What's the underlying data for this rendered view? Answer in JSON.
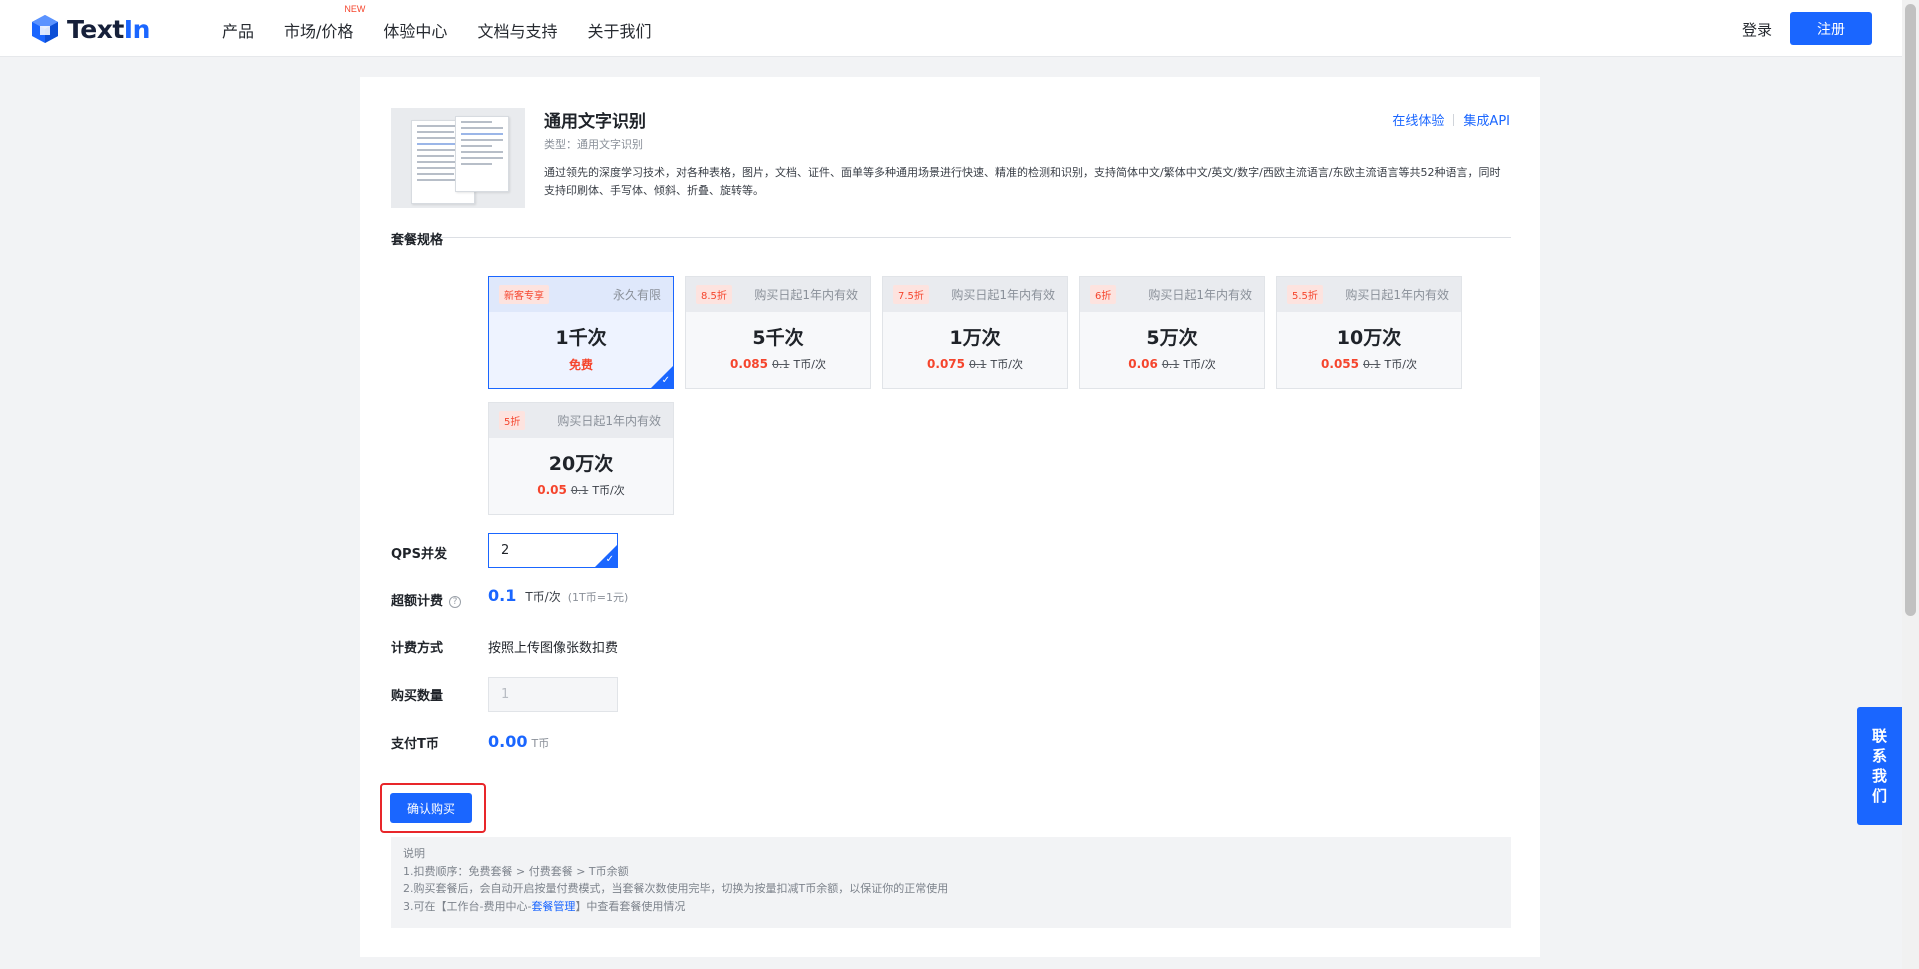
{
  "header": {
    "logo": {
      "text_main": "Text",
      "text_accent": "In"
    },
    "nav": [
      {
        "label": "产品"
      },
      {
        "label": "市场/价格",
        "badge": "NEW"
      },
      {
        "label": "体验中心"
      },
      {
        "label": "文档与支持"
      },
      {
        "label": "关于我们"
      }
    ],
    "login_label": "登录",
    "register_label": "注册"
  },
  "product": {
    "title": "通用文字识别",
    "type": "类型：通用文字识别",
    "description": "通过领先的深度学习技术，对各种表格，图片，文档、证件、面单等多种通用场景进行快速、精准的检测和识别，支持简体中文/繁体中文/英文/数字/西欧主流语言/东欧主流语言等共52种语言，同时支持印刷体、手写体、倾斜、折叠、旋转等。",
    "links": {
      "online_trial": "在线体验",
      "integrate_api": "集成API"
    }
  },
  "labels": {
    "plan_spec": "套餐规格",
    "qps": "QPS并发",
    "overage": "超额计费",
    "billing_method": "计费方式",
    "quantity": "购买数量",
    "pay_tcoin": "支付T币"
  },
  "plans": [
    {
      "badge": "新客专享",
      "validity": "永久有限",
      "name": "1千次",
      "price": "免费",
      "old": "",
      "unit": "",
      "selected": true
    },
    {
      "badge": "8.5折",
      "validity": "购买日起1年内有效",
      "name": "5千次",
      "price": "0.085",
      "old": "0.1",
      "unit": "T币/次",
      "selected": false
    },
    {
      "badge": "7.5折",
      "validity": "购买日起1年内有效",
      "name": "1万次",
      "price": "0.075",
      "old": "0.1",
      "unit": "T币/次",
      "selected": false
    },
    {
      "badge": "6折",
      "validity": "购买日起1年内有效",
      "name": "5万次",
      "price": "0.06",
      "old": "0.1",
      "unit": "T币/次",
      "selected": false
    },
    {
      "badge": "5.5折",
      "validity": "购买日起1年内有效",
      "name": "10万次",
      "price": "0.055",
      "old": "0.1",
      "unit": "T币/次",
      "selected": false
    },
    {
      "badge": "5折",
      "validity": "购买日起1年内有效",
      "name": "20万次",
      "price": "0.05",
      "old": "0.1",
      "unit": "T币/次",
      "selected": false
    }
  ],
  "qps_value": "2",
  "overage": {
    "value": "0.1",
    "unit": "T币/次",
    "note": "(1T币=1元)"
  },
  "billing_method_value": "按照上传图像张数扣费",
  "quantity_value": "1",
  "pay": {
    "value": "0.00",
    "unit": "T币"
  },
  "confirm_label": "确认购买",
  "notes": {
    "title": "说明",
    "line1": "1.扣费顺序：免费套餐 > 付费套餐 > T币余额",
    "line2": "2.购买套餐后，会自动开启按量付费模式，当套餐次数使用完毕，切换为按量扣减T币余额，以保证你的正常使用",
    "line3_pre": "3.可在【工作台-费用中心-",
    "line3_link": "套餐管理",
    "line3_post": "】中查看套餐使用情况"
  },
  "contact": [
    "联",
    "系",
    "我",
    "们"
  ],
  "colors": {
    "accent": "#1a66ff",
    "price_red": "#f5452d",
    "highlight_border": "#e8262a"
  }
}
